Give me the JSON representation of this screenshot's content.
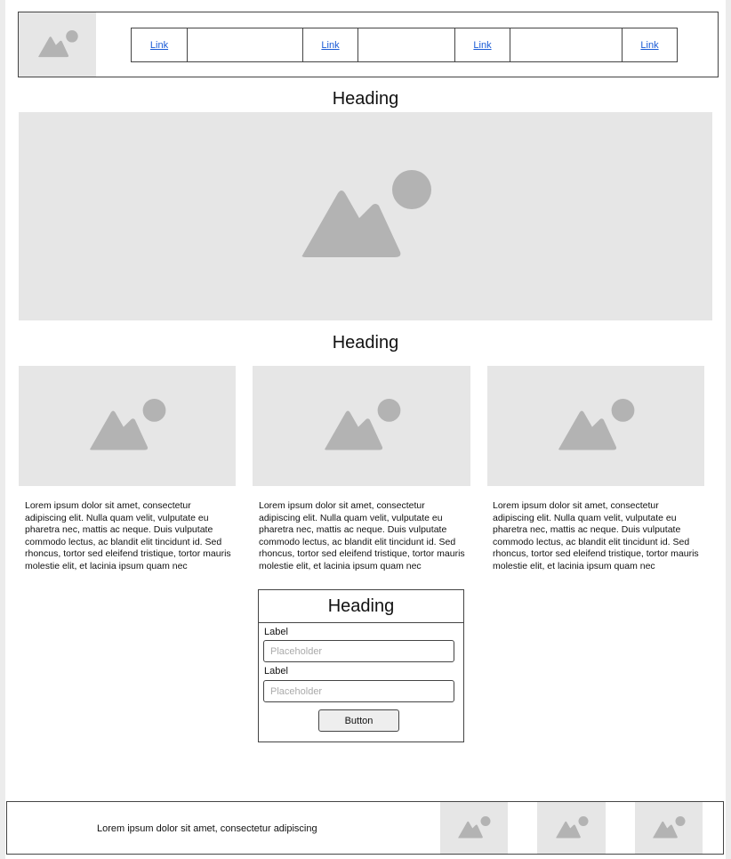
{
  "header": {
    "logo_icon": "image-placeholder-icon",
    "nav_links": [
      {
        "label": "Link"
      },
      {
        "label": "Link"
      },
      {
        "label": "Link"
      },
      {
        "label": "Link"
      }
    ]
  },
  "hero": {
    "heading": "Heading",
    "image_icon": "image-placeholder-icon"
  },
  "cards_section": {
    "heading": "Heading",
    "cards": [
      {
        "text": "Lorem ipsum dolor sit amet, consectetur adipiscing elit. Nulla quam velit, vulputate eu pharetra nec, mattis ac neque. Duis vulputate commodo lectus, ac blandit elit tincidunt id. Sed rhoncus, tortor sed eleifend tristique, tortor mauris molestie elit, et lacinia ipsum quam nec"
      },
      {
        "text": "Lorem ipsum dolor sit amet, consectetur adipiscing elit. Nulla quam velit, vulputate eu pharetra nec, mattis ac neque. Duis vulputate commodo lectus, ac blandit elit tincidunt id. Sed rhoncus, tortor sed eleifend tristique, tortor mauris molestie elit, et lacinia ipsum quam nec"
      },
      {
        "text": "Lorem ipsum dolor sit amet, consectetur adipiscing elit. Nulla quam velit, vulputate eu pharetra nec, mattis ac neque. Duis vulputate commodo lectus, ac blandit elit tincidunt id. Sed rhoncus, tortor sed eleifend tristique, tortor mauris molestie elit, et lacinia ipsum quam nec"
      }
    ]
  },
  "form": {
    "heading": "Heading",
    "fields": [
      {
        "label": "Label",
        "placeholder": "Placeholder"
      },
      {
        "label": "Label",
        "placeholder": "Placeholder"
      }
    ],
    "button_label": "Button"
  },
  "footer": {
    "text": "Lorem ipsum dolor sit amet, consectetur adipiscing"
  },
  "colors": {
    "placeholder_bg": "#e6e6e6",
    "placeholder_icon": "#b3b3b3",
    "link": "#1a5bd6",
    "border": "#444444"
  }
}
